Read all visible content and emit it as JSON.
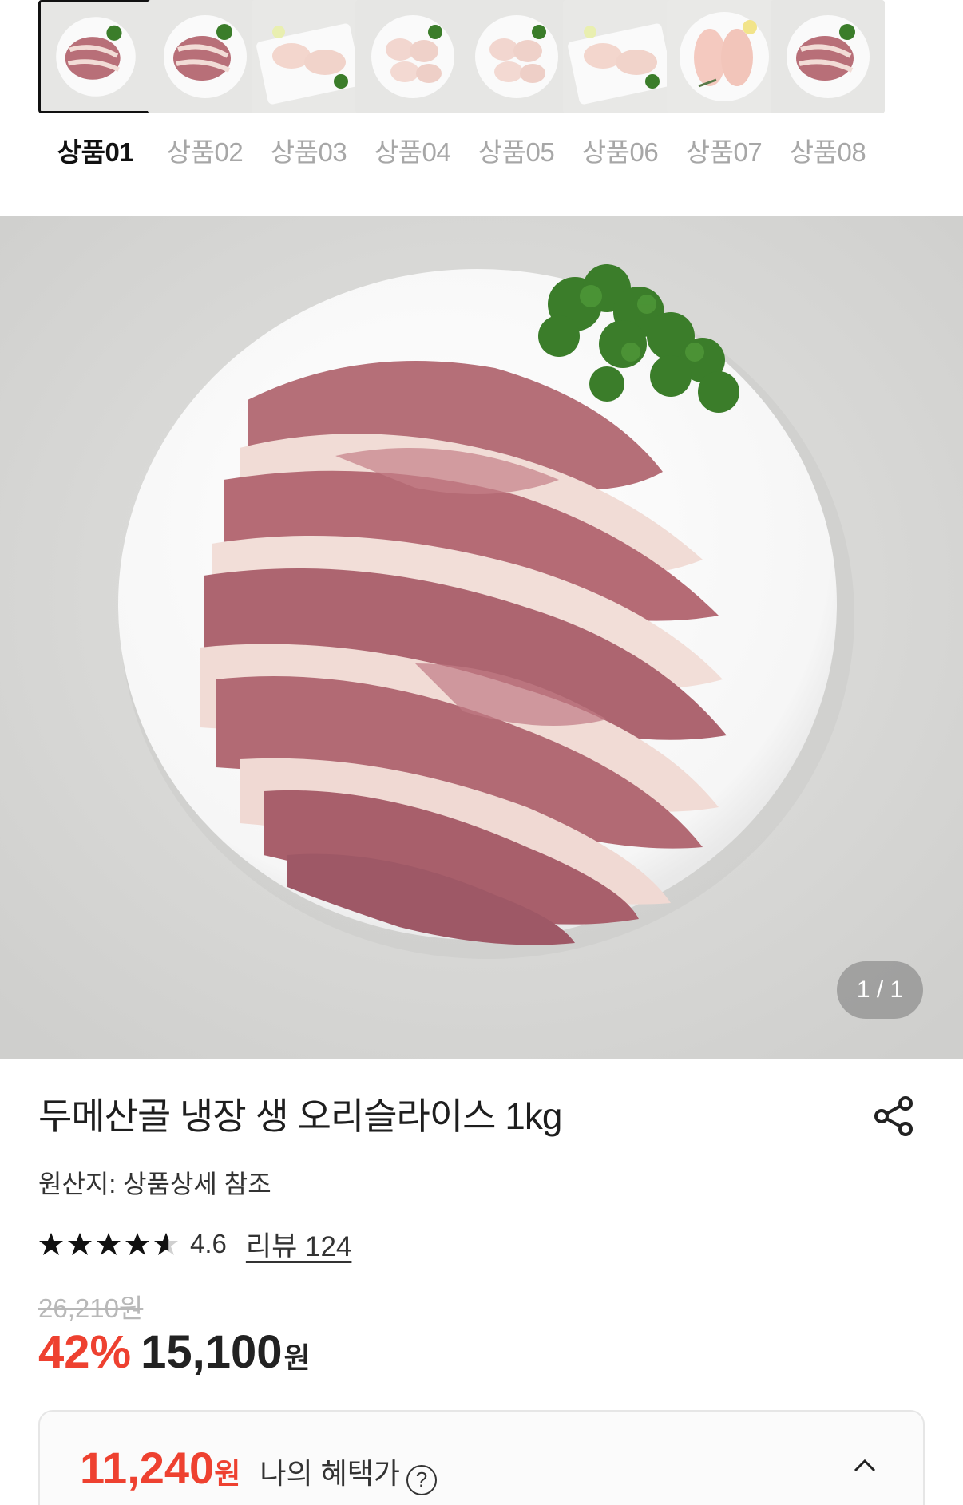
{
  "thumbnails": [
    {
      "label": "상품01",
      "active": true,
      "kind": "duck"
    },
    {
      "label": "상품02",
      "active": false,
      "kind": "duck"
    },
    {
      "label": "상품03",
      "active": false,
      "kind": "legs"
    },
    {
      "label": "상품04",
      "active": false,
      "kind": "pieces"
    },
    {
      "label": "상품05",
      "active": false,
      "kind": "pieces"
    },
    {
      "label": "상품06",
      "active": false,
      "kind": "legs"
    },
    {
      "label": "상품07",
      "active": false,
      "kind": "breast"
    },
    {
      "label": "상품08",
      "active": false,
      "kind": "duck"
    }
  ],
  "hero": {
    "page_indicator": "1 / 1"
  },
  "product": {
    "title": "두메산골 냉장 생 오리슬라이스 1kg",
    "origin": "원산지: 상품상세 참조",
    "rating": {
      "stars": 4.6,
      "value_text": "4.6",
      "review_text": "리뷰 124"
    },
    "original_price": "26,210원",
    "discount": "42%",
    "price": "15,100",
    "currency": "원"
  },
  "benefit": {
    "price": "11,240",
    "currency": "원",
    "label": "나의 혜택가",
    "help_icon": "question-circle-icon",
    "toggle_icon": "chevron-up-icon"
  },
  "colors": {
    "accent": "#ee4130",
    "muted": "#a7a7a7"
  }
}
